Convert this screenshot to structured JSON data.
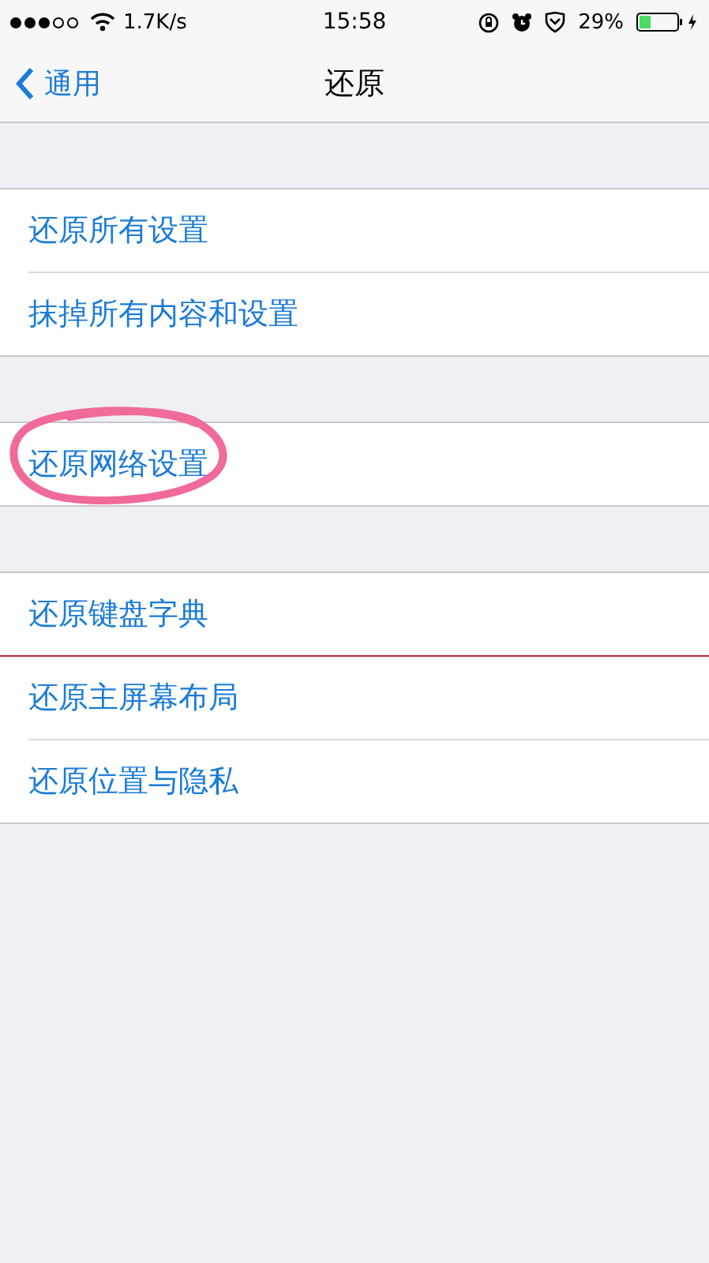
{
  "status_bar": {
    "speed": "1.7K/s",
    "time": "15:58",
    "battery": "29%"
  },
  "nav": {
    "back": "通用",
    "title": "还原"
  },
  "groups": [
    {
      "items": [
        {
          "label": "还原所有设置"
        },
        {
          "label": "抹掉所有内容和设置"
        }
      ]
    },
    {
      "items": [
        {
          "label": "还原网络设置",
          "circled": true
        }
      ]
    },
    {
      "items": [
        {
          "label": "还原键盘字典"
        },
        {
          "label": "还原主屏幕布局"
        },
        {
          "label": "还原位置与隐私"
        }
      ]
    }
  ]
}
